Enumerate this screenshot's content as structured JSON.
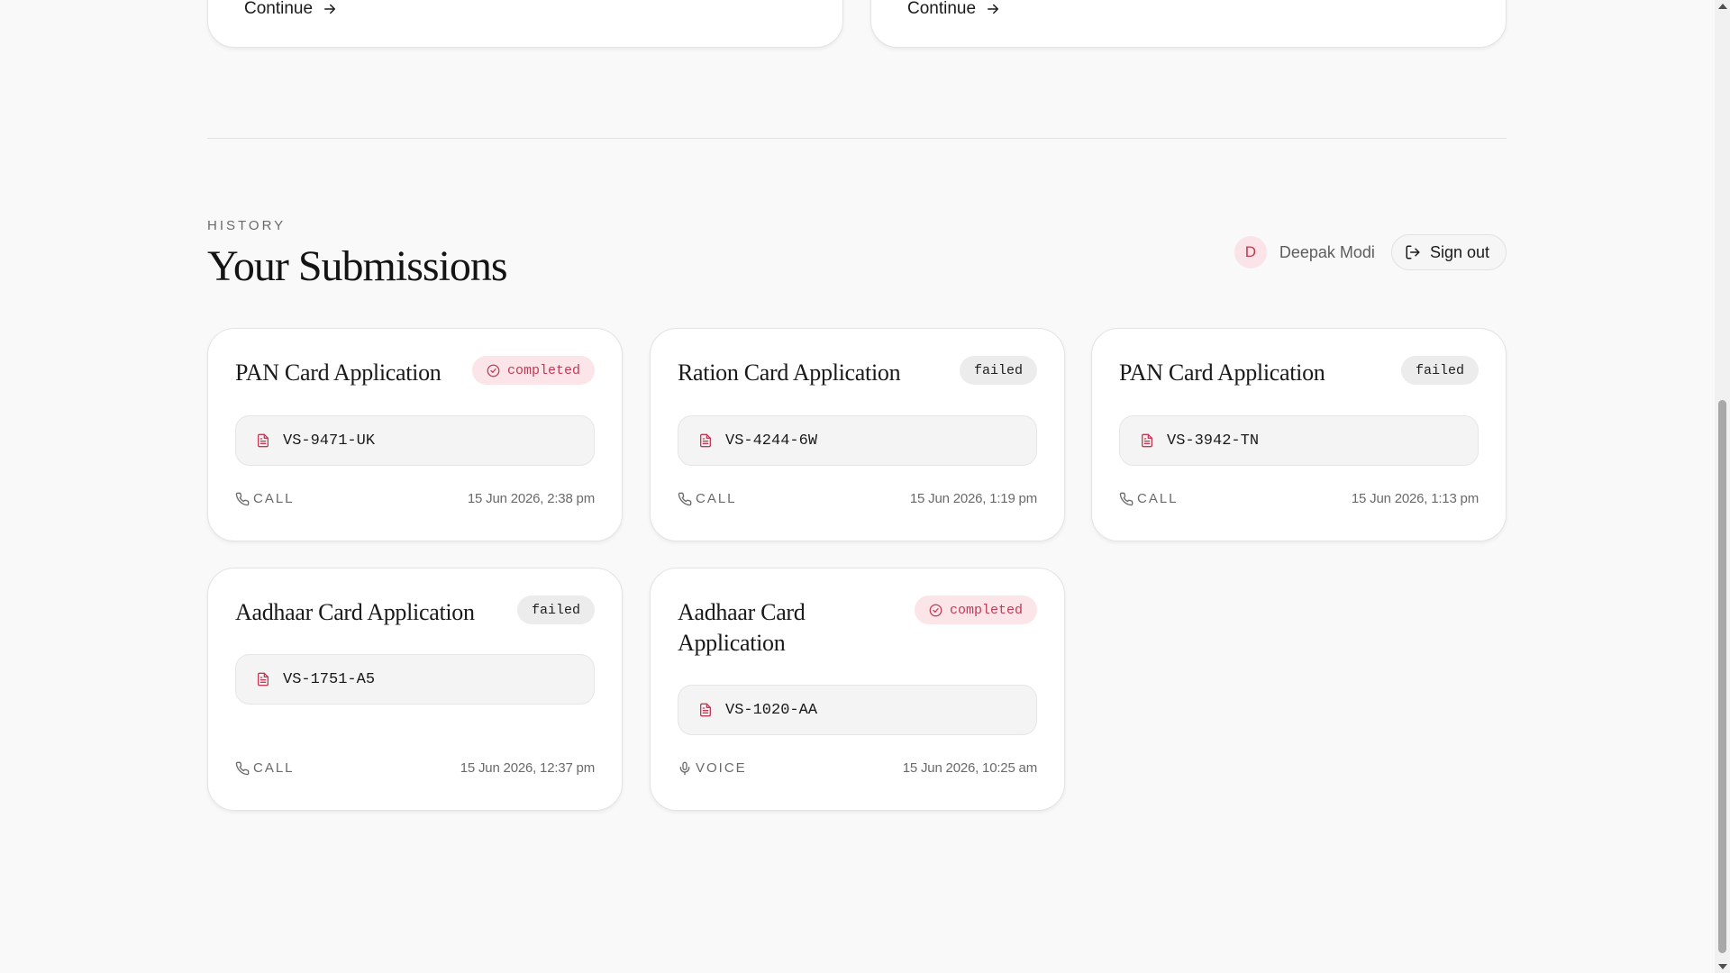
{
  "top_cards": [
    {
      "label": "Continue"
    },
    {
      "label": "Continue"
    }
  ],
  "section": {
    "eyebrow": "HISTORY",
    "title": "Your Submissions"
  },
  "user": {
    "initial": "D",
    "name": "Deepak Modi",
    "signout_label": "Sign out"
  },
  "colors": {
    "accent": "#c23a55",
    "completed_bg": "#fbe5e9",
    "failed_bg": "#ececec"
  },
  "submissions": [
    {
      "title": "PAN Card Application",
      "status": "completed",
      "reference": "VS-9471-UK",
      "channel": "CALL",
      "date": "15 Jun 2026, 2:38 pm"
    },
    {
      "title": "Ration Card Application",
      "status": "failed",
      "reference": "VS-4244-6W",
      "channel": "CALL",
      "date": "15 Jun 2026, 1:19 pm"
    },
    {
      "title": "PAN Card Application",
      "status": "failed",
      "reference": "VS-3942-TN",
      "channel": "CALL",
      "date": "15 Jun 2026, 1:13 pm"
    },
    {
      "title": "Aadhaar Card Application",
      "status": "failed",
      "reference": "VS-1751-A5",
      "channel": "CALL",
      "date": "15 Jun 2026, 12:37 pm"
    },
    {
      "title": "Aadhaar Card Application",
      "status": "completed",
      "reference": "VS-1020-AA",
      "channel": "VOICE",
      "date": "15 Jun 2026, 10:25 am"
    }
  ]
}
